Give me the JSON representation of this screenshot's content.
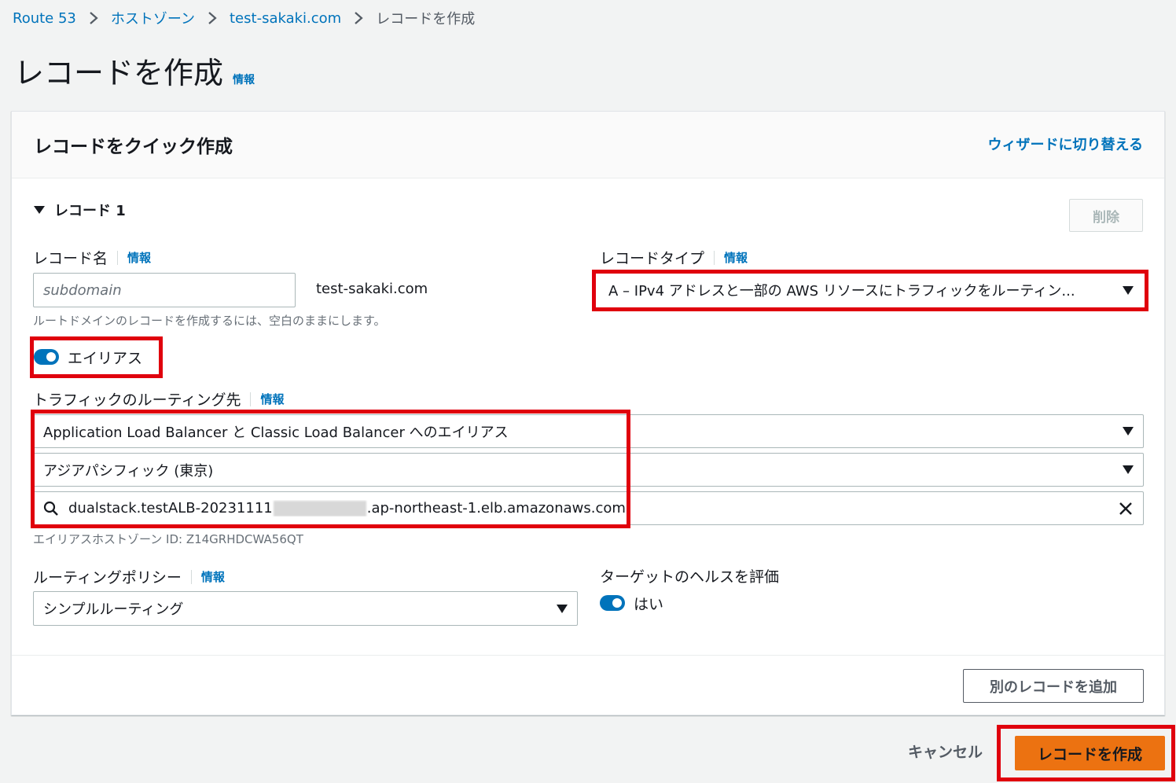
{
  "breadcrumb": {
    "items": [
      "Route 53",
      "ホストゾーン",
      "test-sakaki.com"
    ],
    "current": "レコードを作成"
  },
  "page": {
    "title": "レコードを作成",
    "info": "情報"
  },
  "panel": {
    "title": "レコードをクイック作成",
    "wizard_link": "ウィザードに切り替える"
  },
  "record": {
    "section_label": "レコード 1",
    "delete_label": "削除",
    "name": {
      "label": "レコード名",
      "info": "情報",
      "placeholder": "subdomain",
      "suffix": "test-sakaki.com",
      "hint": "ルートドメインのレコードを作成するには、空白のままにします。"
    },
    "type": {
      "label": "レコードタイプ",
      "info": "情報",
      "value": "A – IPv4 アドレスと一部の AWS リソースにトラフィックをルーティン..."
    },
    "alias": {
      "label": "エイリアス",
      "enabled": true
    },
    "routing_target": {
      "label": "トラフィックのルーティング先",
      "info": "情報",
      "endpoint": "Application Load Balancer と Classic Load Balancer へのエイリアス",
      "region": "アジアパシフィック (東京)",
      "search_prefix": "dualstack.testALB-20231111",
      "search_suffix": ".ap-northeast-1.elb.amazonaws.com",
      "hosted_zone_hint": "エイリアスホストゾーン ID: Z14GRHDCWA56QT"
    },
    "routing_policy": {
      "label": "ルーティングポリシー",
      "info": "情報",
      "value": "シンプルルーティング"
    },
    "health": {
      "label": "ターゲットのヘルスを評価",
      "toggle_label": "はい",
      "enabled": true
    }
  },
  "actions": {
    "add_record": "別のレコードを追加",
    "cancel": "キャンセル",
    "create": "レコードを作成"
  },
  "colors": {
    "link": "#0073bb",
    "primary_button": "#ec7211",
    "highlight": "#e0000d"
  }
}
